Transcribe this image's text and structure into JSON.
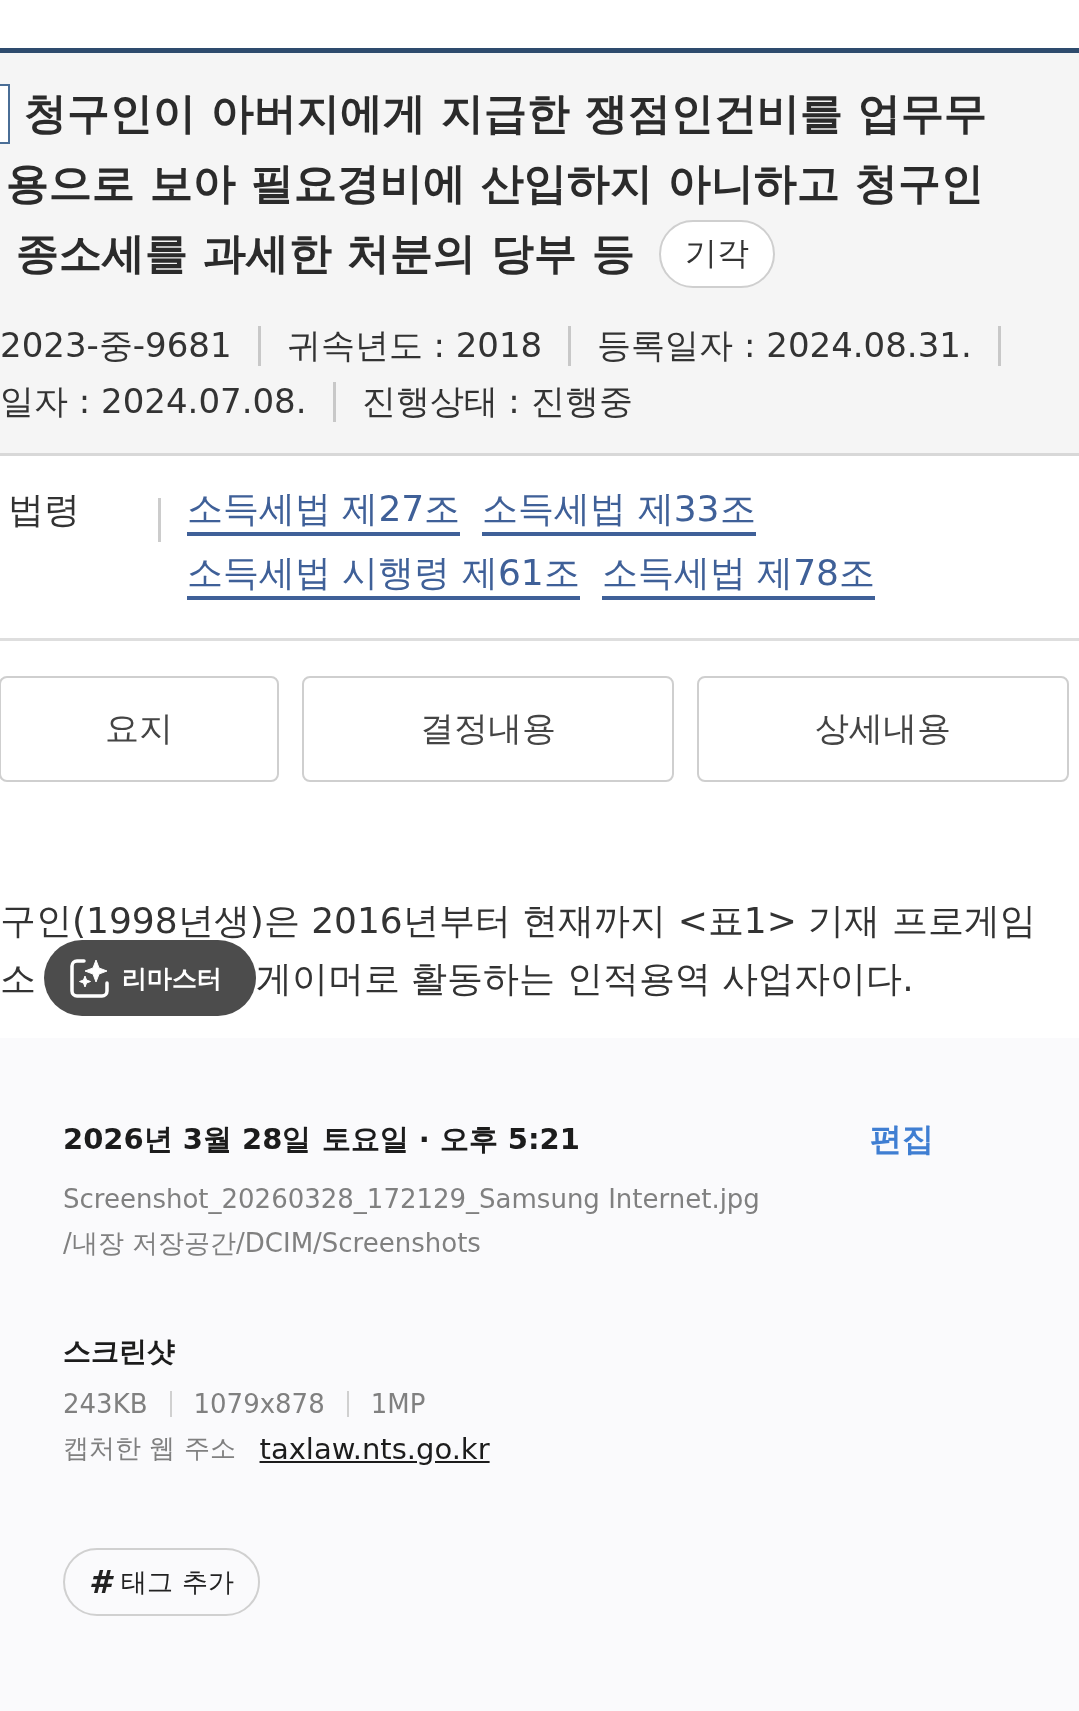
{
  "screenshot": {
    "title_lines": [
      "청구인이 아버지에게 지급한 쟁점인건비를 업무무",
      "용으로 보아 필요경비에 산입하지 아니하고 청구인",
      "종소세를 과세한 처분의 당부 등"
    ],
    "status_badge": "기각",
    "meta_lines": [
      [
        "2023-중-9681",
        "귀속년도 : 2018",
        "등록일자 : 2024.08.31."
      ],
      [
        "일자 : 2024.07.08.",
        "진행상태 : 진행중"
      ]
    ],
    "laws": {
      "label": "법령",
      "rows": [
        [
          "소득세법 제27조",
          "소득세법 제33조"
        ],
        [
          "소득세법 시행령 제61조",
          "소득세법 제78조"
        ]
      ]
    },
    "buttons": [
      "요지",
      "결정내용",
      "상세내용"
    ],
    "paragraph": {
      "line_1": "구인(1998년생)은 2016년부터 현재까지 <표1> 기재 프로게임",
      "line_2_start": "소",
      "line_2_end": "게이머로 활동하는 인적용역 사업자이다."
    }
  },
  "remaster_button": "리마스터",
  "details": {
    "date": "2026년 3월 28일 토요일 · 오후 5:21",
    "edit": "편집",
    "filename": "Screenshot_20260328_172129_Samsung Internet.jpg",
    "path": "/내장 저장공간/DCIM/Screenshots",
    "category": "스크린샷",
    "specs": [
      "243KB",
      "1079x878",
      "1MP"
    ],
    "url_label": "캡처한 웹 주소",
    "url": "taxlaw.nts.go.kr",
    "tag_button": {
      "icon": "#",
      "label": "태그 추가"
    }
  }
}
